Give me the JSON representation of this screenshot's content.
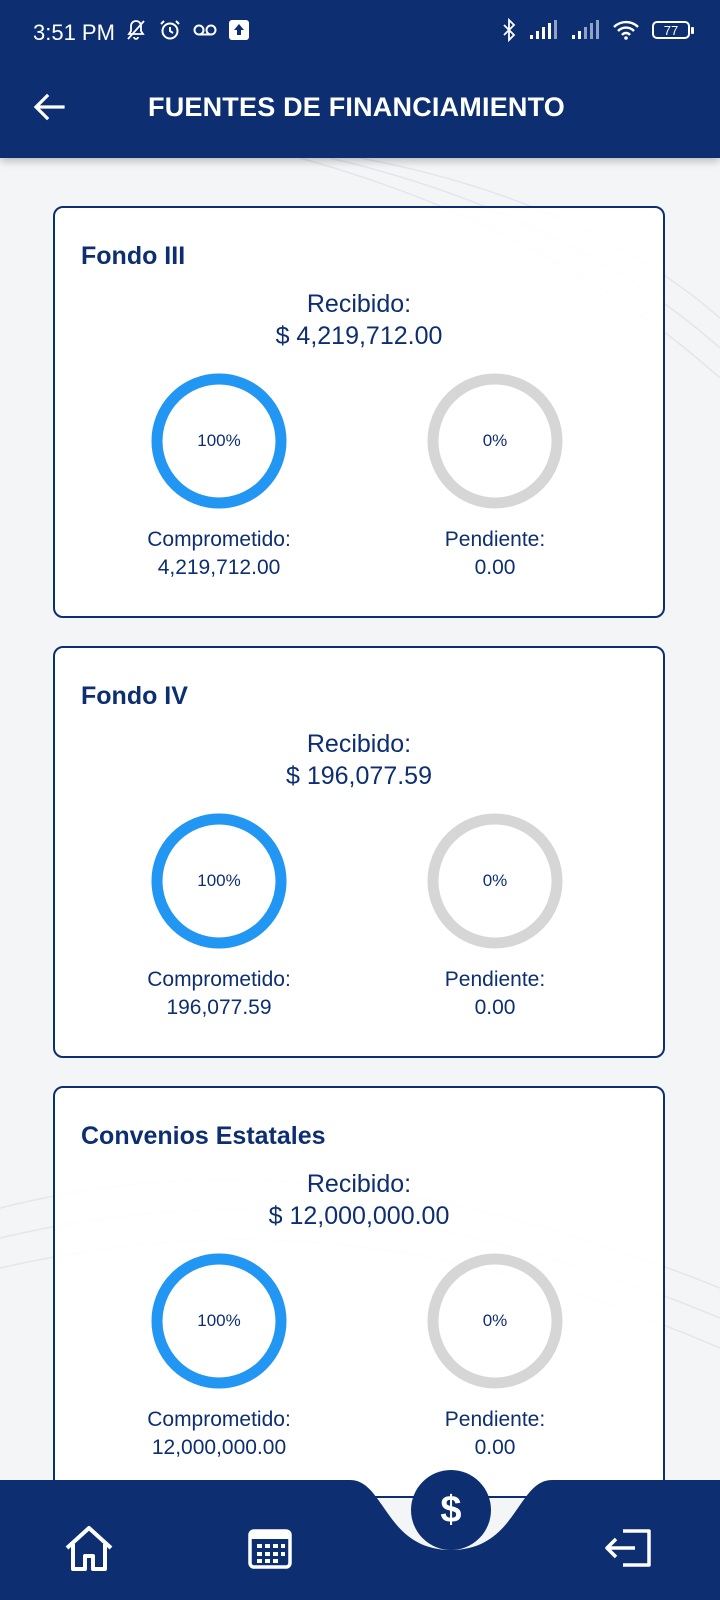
{
  "status_bar": {
    "time": "3:51 PM",
    "battery": "77"
  },
  "header": {
    "title": "FUENTES DE FINANCIAMIENTO",
    "back_icon": "arrow-left-icon"
  },
  "colors": {
    "primary": "#0d2f72",
    "progress_blue": "#2196f3",
    "track_gray": "#d6d6d6"
  },
  "funds": [
    {
      "name": "Fondo III",
      "received_label": "Recibido:",
      "received_value": "$ 4,219,712.00",
      "committed_percent": 100,
      "committed_percent_text": "100%",
      "pending_percent": 0,
      "pending_percent_text": "0%",
      "committed_label": "Comprometido:",
      "committed_value": "4,219,712.00",
      "pending_label": "Pendiente:",
      "pending_value": "0.00"
    },
    {
      "name": "Fondo IV",
      "received_label": "Recibido:",
      "received_value": "$ 196,077.59",
      "committed_percent": 100,
      "committed_percent_text": "100%",
      "pending_percent": 0,
      "pending_percent_text": "0%",
      "committed_label": "Comprometido:",
      "committed_value": "196,077.59",
      "pending_label": "Pendiente:",
      "pending_value": "0.00"
    },
    {
      "name": "Convenios Estatales",
      "received_label": "Recibido:",
      "received_value": "$ 12,000,000.00",
      "committed_percent": 100,
      "committed_percent_text": "100%",
      "pending_percent": 0,
      "pending_percent_text": "0%",
      "committed_label": "Comprometido:",
      "committed_value": "12,000,000.00",
      "pending_label": "Pendiente:",
      "pending_value": "0.00"
    }
  ],
  "bottom_nav": {
    "home_icon": "home-icon",
    "calendar_icon": "calendar-icon",
    "fab_label": "$",
    "logout_icon": "logout-icon"
  }
}
